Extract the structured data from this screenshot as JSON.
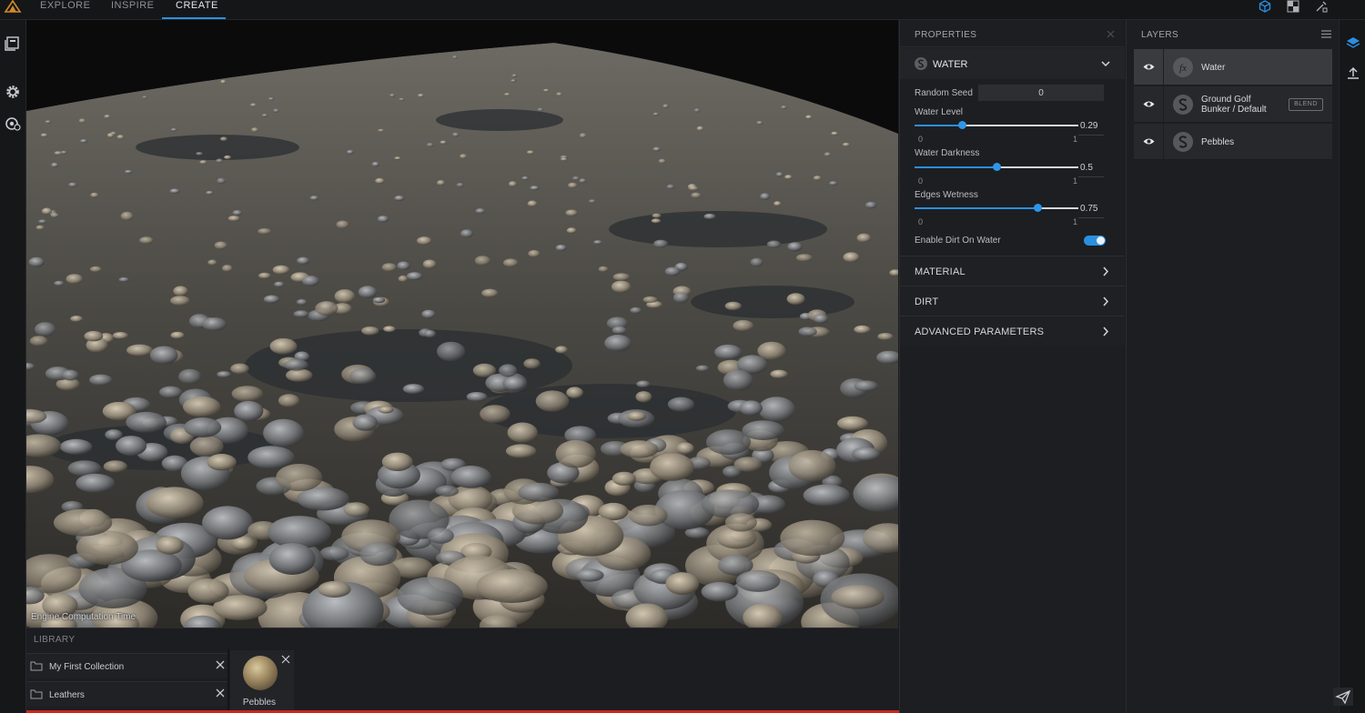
{
  "topbar": {
    "tabs": [
      {
        "label": "EXPLORE"
      },
      {
        "label": "INSPIRE"
      },
      {
        "label": "CREATE"
      }
    ],
    "active_tab": "CREATE",
    "icons": [
      "logo-icon",
      "3d-view-icon",
      "2d-view-icon",
      "tools-icon"
    ]
  },
  "left_toolbar": {
    "icons": [
      "library-icon",
      "settings-icon",
      "render-settings-icon"
    ]
  },
  "viewport": {
    "overlay_label": "Engine Computation Time"
  },
  "library": {
    "title": "LIBRARY",
    "collections": [
      {
        "label": "My First Collection"
      },
      {
        "label": "Leathers"
      }
    ],
    "items": [
      {
        "name": "Pebbles"
      }
    ]
  },
  "properties": {
    "title": "PROPERTIES",
    "layer_section": {
      "title": "WATER",
      "random_seed": {
        "label": "Random Seed",
        "value": "0"
      },
      "sliders": [
        {
          "label": "Water Level",
          "value": "0.29",
          "fraction": 0.29,
          "min": "0",
          "max": "1"
        },
        {
          "label": "Water Darkness",
          "value": "0.5",
          "fraction": 0.5,
          "min": "0",
          "max": "1"
        },
        {
          "label": "Edges Wetness",
          "value": "0.75",
          "fraction": 0.75,
          "min": "0",
          "max": "1"
        }
      ],
      "toggle": {
        "label": "Enable Dirt On Water",
        "on": true
      }
    },
    "sections": [
      {
        "title": "MATERIAL"
      },
      {
        "title": "DIRT"
      },
      {
        "title": "ADVANCED PARAMETERS"
      }
    ]
  },
  "layers": {
    "title": "LAYERS",
    "items": [
      {
        "name": "Water",
        "selected": true,
        "icon": "fx-icon"
      },
      {
        "name_line1": "Ground Golf",
        "name_line2": "Bunker / Default",
        "badge": "BLEND",
        "icon": "substance-icon"
      },
      {
        "name": "Pebbles",
        "icon": "substance-icon"
      }
    ]
  },
  "right_strip": {
    "icons": [
      "layers-icon",
      "export-icon",
      "send-feedback-icon"
    ]
  },
  "colors": {
    "accent": "#2a8fe0",
    "background": "#1b1c1e",
    "panel": "#1d1e21"
  }
}
